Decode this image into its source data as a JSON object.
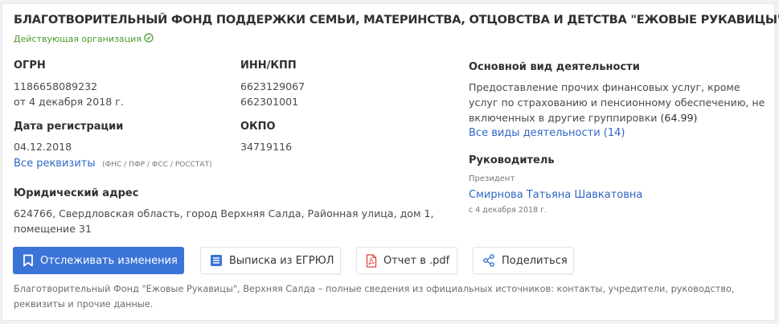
{
  "org": {
    "title": "БЛАГОТВОРИТЕЛЬНЫЙ ФОНД ПОДДЕРЖКИ СЕМЬИ, МАТЕРИНСТВА, ОТЦОВСТВА И ДЕТСТВА \"ЕЖОВЫЕ РУКАВИЦЫ\"",
    "status": "Действующая организация"
  },
  "ogrn": {
    "label": "ОГРН",
    "value": "1186658089232",
    "date": "от 4 декабря 2018 г."
  },
  "inn": {
    "label": "ИНН/КПП",
    "inn": "6623129067",
    "kpp": "662301001"
  },
  "reg": {
    "label": "Дата регистрации",
    "value": "04.12.2018"
  },
  "okpo": {
    "label": "ОКПО",
    "value": "34719116"
  },
  "requisites": {
    "link": "Все реквизиты",
    "note": "(ФНС / ПФР / ФСС / РОССТАТ)"
  },
  "address": {
    "label": "Юридический адрес",
    "line1": "624766, Свердловская область, город Верхняя Салда, Районная улица, дом 1,",
    "line2": "помещение 31"
  },
  "activity": {
    "label": "Основной вид деятельности",
    "line1": "Предоставление прочих финансовых услуг, кроме",
    "line2": "услуг по страхованию и пенсионному обеспечению, не",
    "line3": "включенных в другие группировки",
    "code": "(64.99)",
    "all_link": "Все виды деятельности (14)"
  },
  "head": {
    "label": "Руководитель",
    "role": "Президент",
    "name": "Смирнова Татьяна Шавкатовна",
    "since": "с 4 декабря 2018 г."
  },
  "buttons": {
    "track": "Отслеживать изменения",
    "egrul": "Выписка из ЕГРЮЛ",
    "pdf": "Отчет в .pdf",
    "share": "Поделиться"
  },
  "footer": {
    "line1": "Благотворительный Фонд \"Ежовые Рукавицы\", Верхняя Салда – полные сведения из официальных источников: контакты, учредители, руководство,",
    "line2": "реквизиты и прочие данные."
  },
  "colors": {
    "link": "#2f68c4",
    "primary": "#3a74d6",
    "active": "#4c9a2a",
    "pdf_icon": "#e0463d"
  }
}
